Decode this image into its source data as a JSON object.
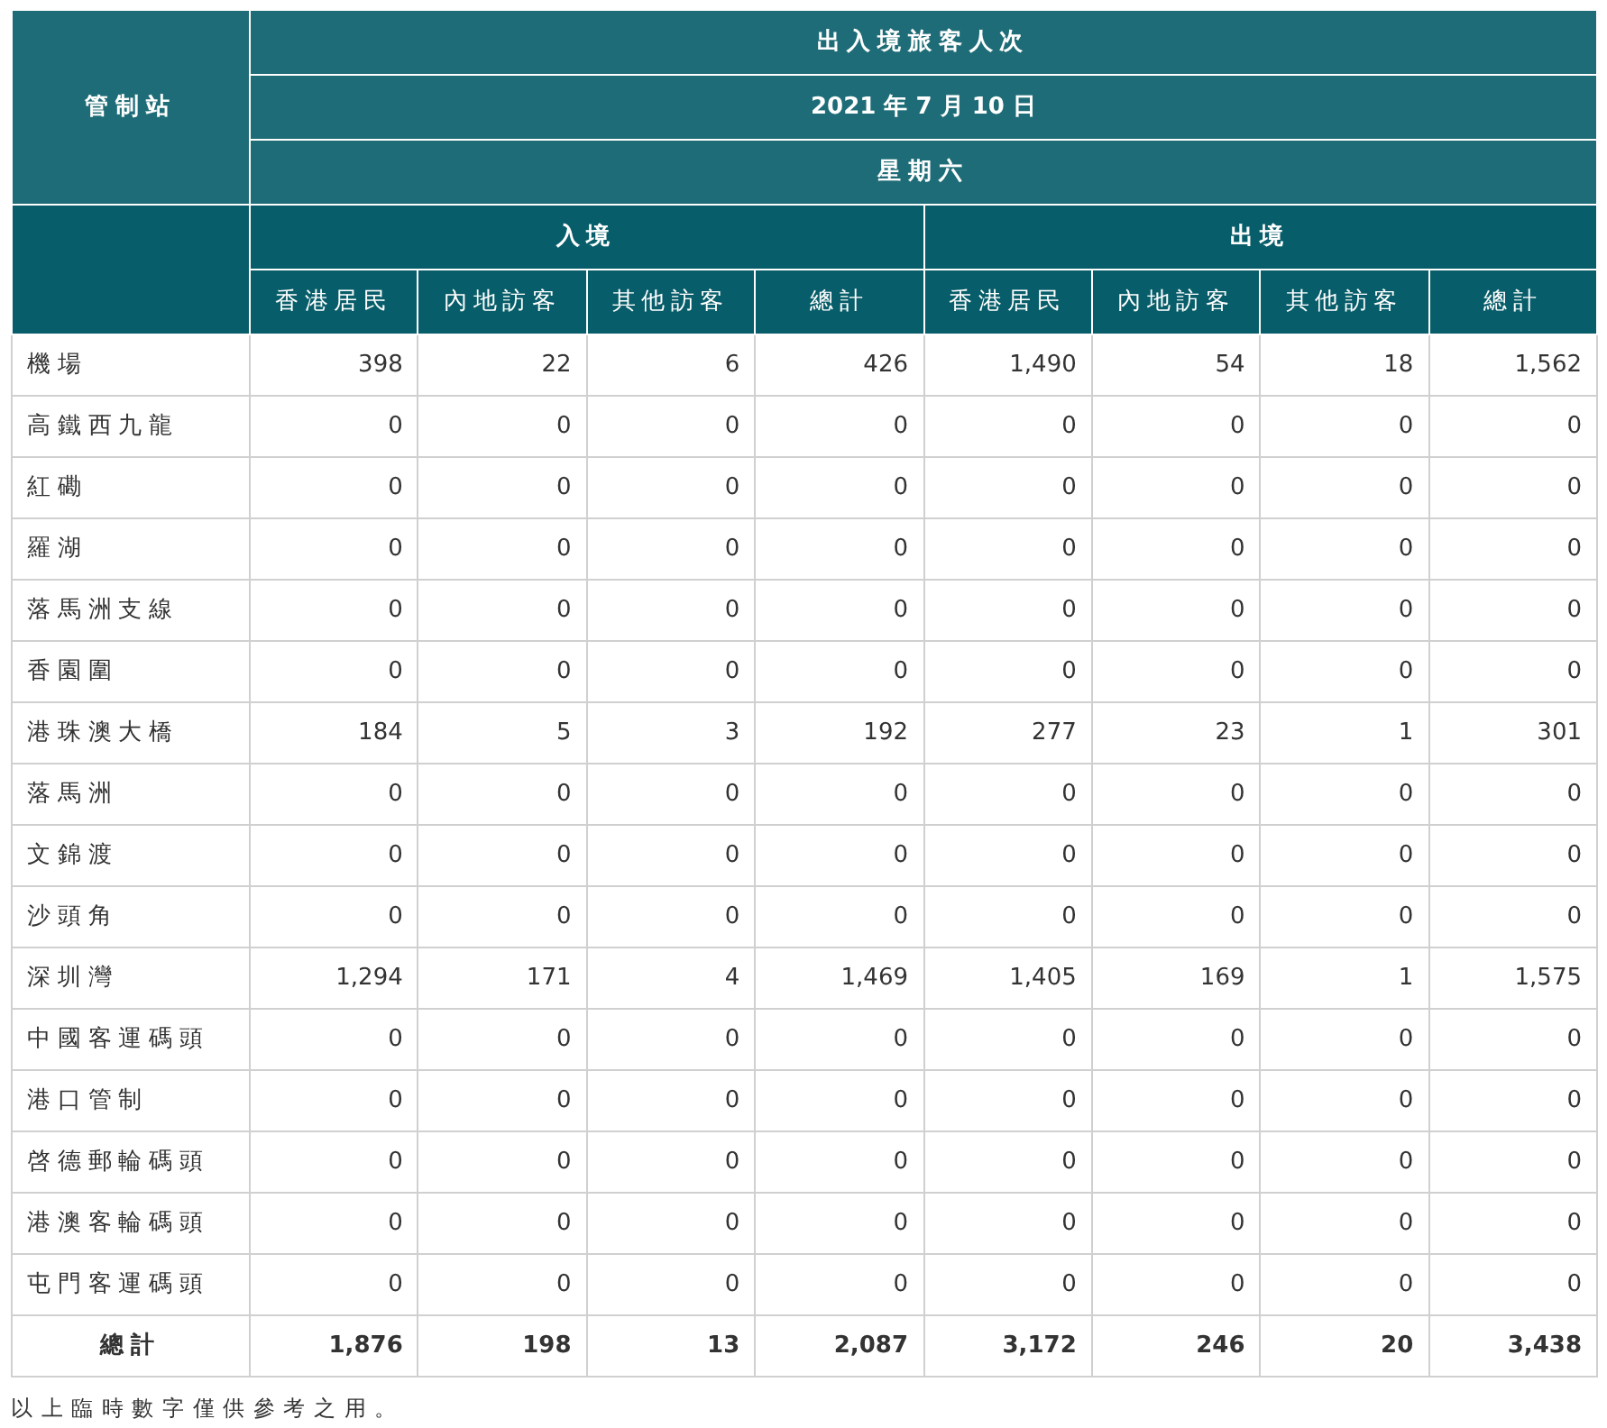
{
  "table": {
    "title": "出入境旅客人次",
    "date": "2021 年 7 月 10 日",
    "weekday": "星期六",
    "station_header": "管制站",
    "groups": [
      "入境",
      "出境"
    ],
    "columns": [
      "香港居民",
      "內地訪客",
      "其他訪客",
      "總計",
      "香港居民",
      "內地訪客",
      "其他訪客",
      "總計"
    ],
    "rows": [
      {
        "station": "機場",
        "values": [
          "398",
          "22",
          "6",
          "426",
          "1,490",
          "54",
          "18",
          "1,562"
        ]
      },
      {
        "station": "高鐵西九龍",
        "values": [
          "0",
          "0",
          "0",
          "0",
          "0",
          "0",
          "0",
          "0"
        ]
      },
      {
        "station": "紅磡",
        "values": [
          "0",
          "0",
          "0",
          "0",
          "0",
          "0",
          "0",
          "0"
        ]
      },
      {
        "station": "羅湖",
        "values": [
          "0",
          "0",
          "0",
          "0",
          "0",
          "0",
          "0",
          "0"
        ]
      },
      {
        "station": "落馬洲支線",
        "values": [
          "0",
          "0",
          "0",
          "0",
          "0",
          "0",
          "0",
          "0"
        ]
      },
      {
        "station": "香園圍",
        "values": [
          "0",
          "0",
          "0",
          "0",
          "0",
          "0",
          "0",
          "0"
        ]
      },
      {
        "station": "港珠澳大橋",
        "values": [
          "184",
          "5",
          "3",
          "192",
          "277",
          "23",
          "1",
          "301"
        ]
      },
      {
        "station": "落馬洲",
        "values": [
          "0",
          "0",
          "0",
          "0",
          "0",
          "0",
          "0",
          "0"
        ]
      },
      {
        "station": "文錦渡",
        "values": [
          "0",
          "0",
          "0",
          "0",
          "0",
          "0",
          "0",
          "0"
        ]
      },
      {
        "station": "沙頭角",
        "values": [
          "0",
          "0",
          "0",
          "0",
          "0",
          "0",
          "0",
          "0"
        ]
      },
      {
        "station": "深圳灣",
        "values": [
          "1,294",
          "171",
          "4",
          "1,469",
          "1,405",
          "169",
          "1",
          "1,575"
        ]
      },
      {
        "station": "中國客運碼頭",
        "values": [
          "0",
          "0",
          "0",
          "0",
          "0",
          "0",
          "0",
          "0"
        ]
      },
      {
        "station": "港口管制",
        "values": [
          "0",
          "0",
          "0",
          "0",
          "0",
          "0",
          "0",
          "0"
        ]
      },
      {
        "station": "啓德郵輪碼頭",
        "values": [
          "0",
          "0",
          "0",
          "0",
          "0",
          "0",
          "0",
          "0"
        ]
      },
      {
        "station": "港澳客輪碼頭",
        "values": [
          "0",
          "0",
          "0",
          "0",
          "0",
          "0",
          "0",
          "0"
        ]
      },
      {
        "station": "屯門客運碼頭",
        "values": [
          "0",
          "0",
          "0",
          "0",
          "0",
          "0",
          "0",
          "0"
        ]
      }
    ],
    "total": {
      "station": "總計",
      "values": [
        "1,876",
        "198",
        "13",
        "2,087",
        "3,172",
        "246",
        "20",
        "3,438"
      ]
    }
  },
  "note": "以上臨時數字僅供參考之用。"
}
